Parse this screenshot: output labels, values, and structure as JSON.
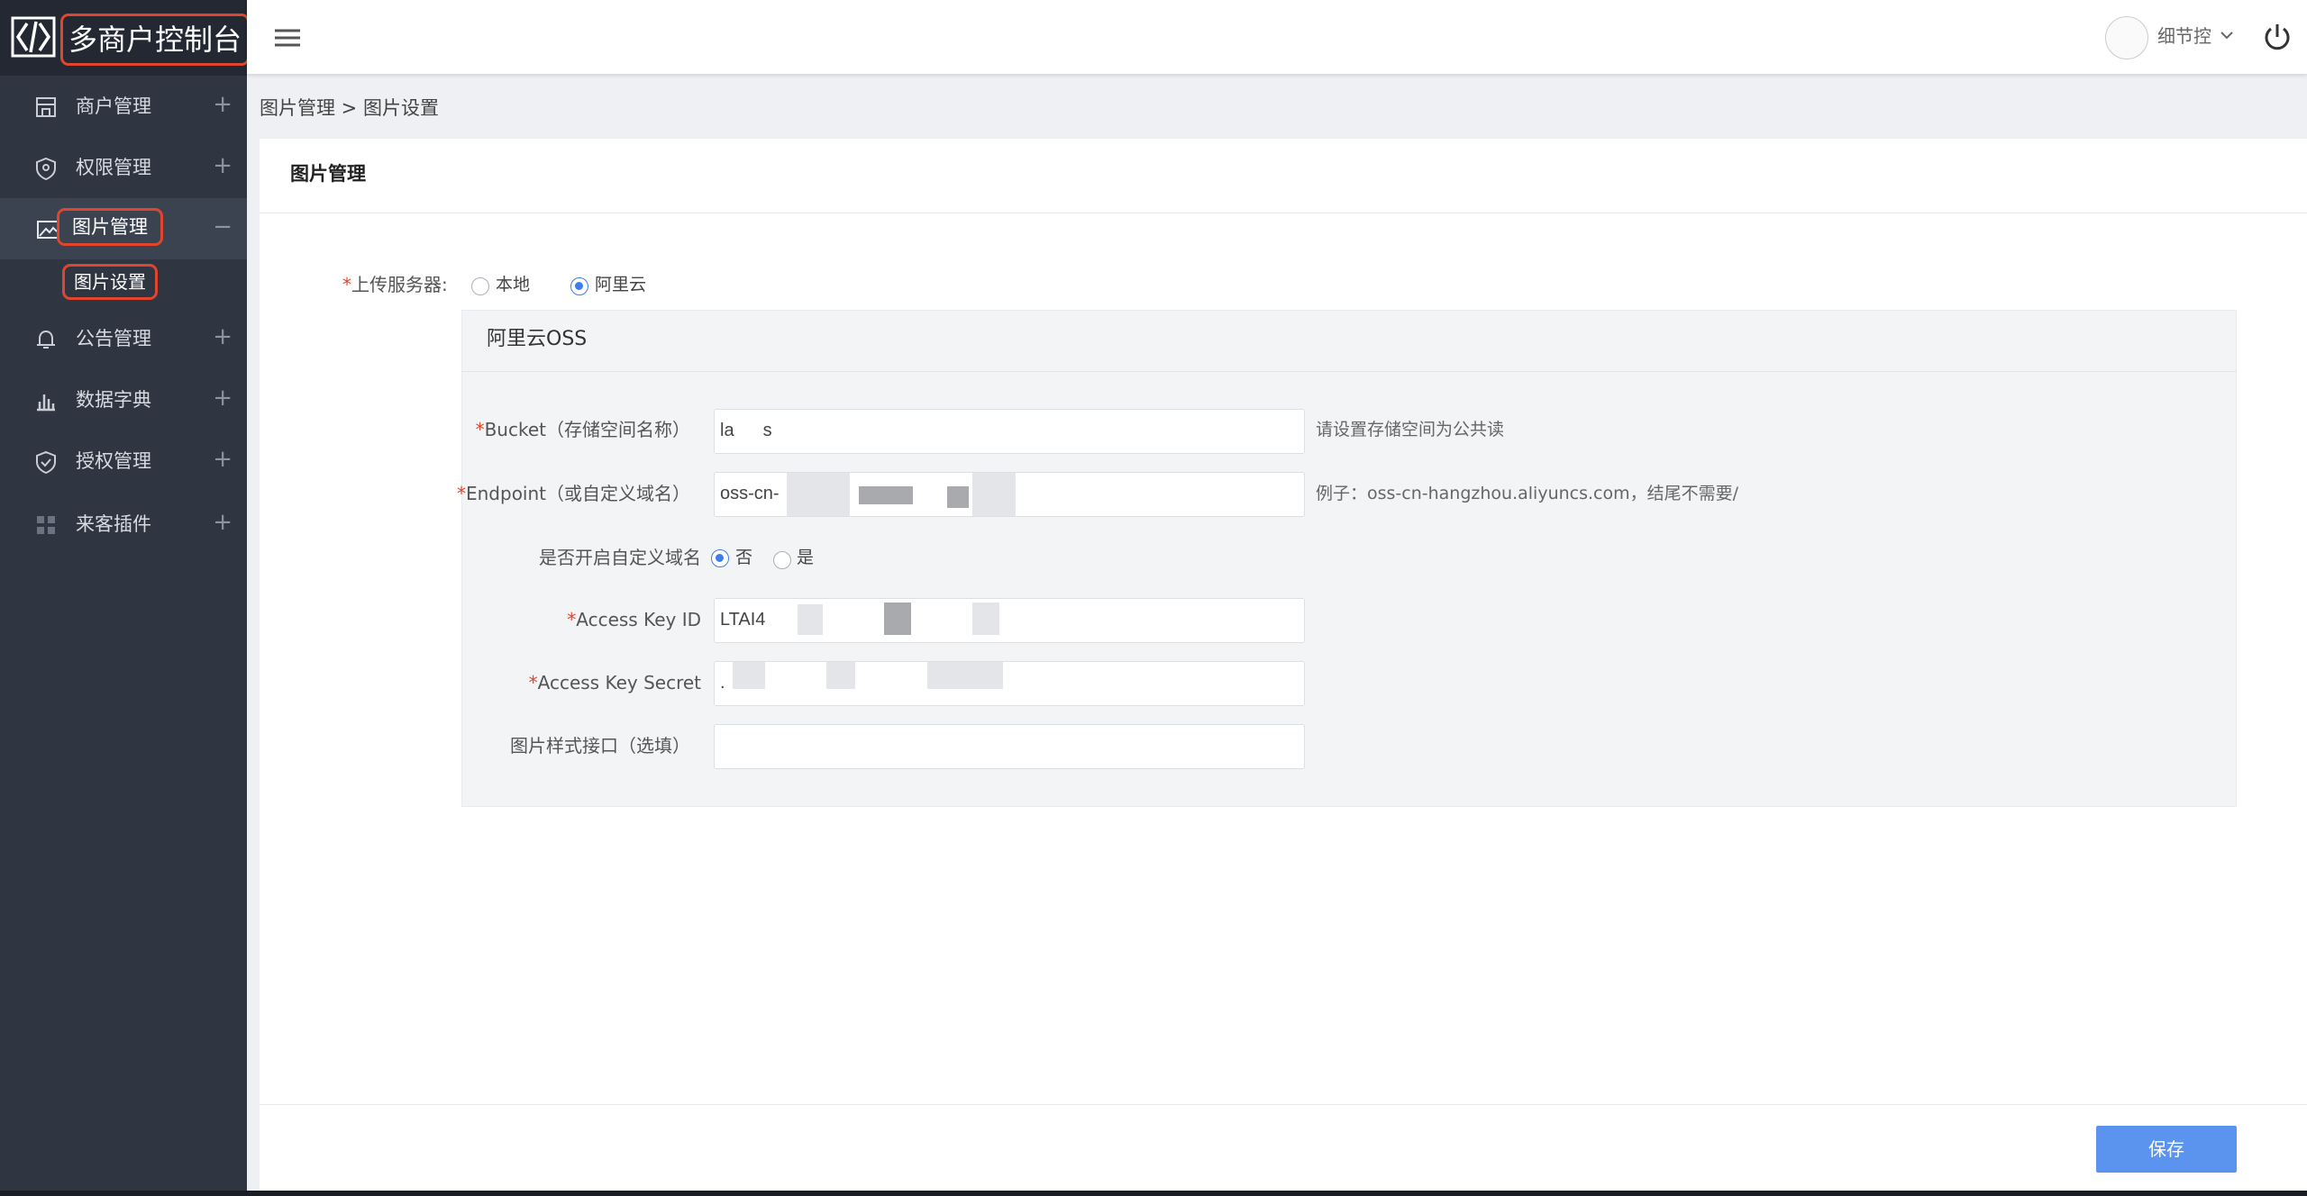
{
  "app": {
    "title": "多商户控制台"
  },
  "sidebar": {
    "items": [
      {
        "label": "商户管理",
        "toggle": "+",
        "icon": "store-icon"
      },
      {
        "label": "权限管理",
        "toggle": "+",
        "icon": "shield-icon"
      },
      {
        "label": "图片管理",
        "toggle": "−",
        "icon": "image-icon",
        "active": true
      },
      {
        "label": "公告管理",
        "toggle": "+",
        "icon": "bell-icon"
      },
      {
        "label": "数据字典",
        "toggle": "+",
        "icon": "bar-chart-icon"
      },
      {
        "label": "授权管理",
        "toggle": "+",
        "icon": "authorize-icon"
      },
      {
        "label": "来客插件",
        "toggle": "+",
        "icon": "plugin-icon"
      }
    ],
    "sub_item": "图片设置"
  },
  "topbar": {
    "username": "细节控"
  },
  "breadcrumb": "图片管理 > 图片设置",
  "page": {
    "card_title": "图片管理"
  },
  "form": {
    "upload_server": {
      "label": "上传服务器:",
      "options": [
        "本地",
        "阿里云"
      ],
      "selected": "阿里云"
    },
    "oss": {
      "title": "阿里云OSS",
      "bucket": {
        "label": "Bucket（存储空间名称）",
        "value_start": "la",
        "value_end": "s",
        "hint": "请设置存储空间为公共读"
      },
      "endpoint": {
        "label": "Endpoint（或自定义域名）",
        "value": "oss-cn-",
        "hint": "例子：oss-cn-hangzhou.aliyuncs.com，结尾不需要/"
      },
      "custom_domain": {
        "label": "是否开启自定义域名",
        "options": [
          "否",
          "是"
        ],
        "selected": "否"
      },
      "access_key_id": {
        "label": "Access Key ID",
        "value": "LTAI4"
      },
      "access_key_secret": {
        "label": "Access Key Secret",
        "value": "."
      },
      "style_api": {
        "label": "图片样式接口（选填）",
        "value": ""
      }
    },
    "save_label": "保存"
  },
  "colors": {
    "accent": "#5b94ee",
    "sidebar_bg": "#2f3541",
    "highlight": "#e0452d"
  }
}
